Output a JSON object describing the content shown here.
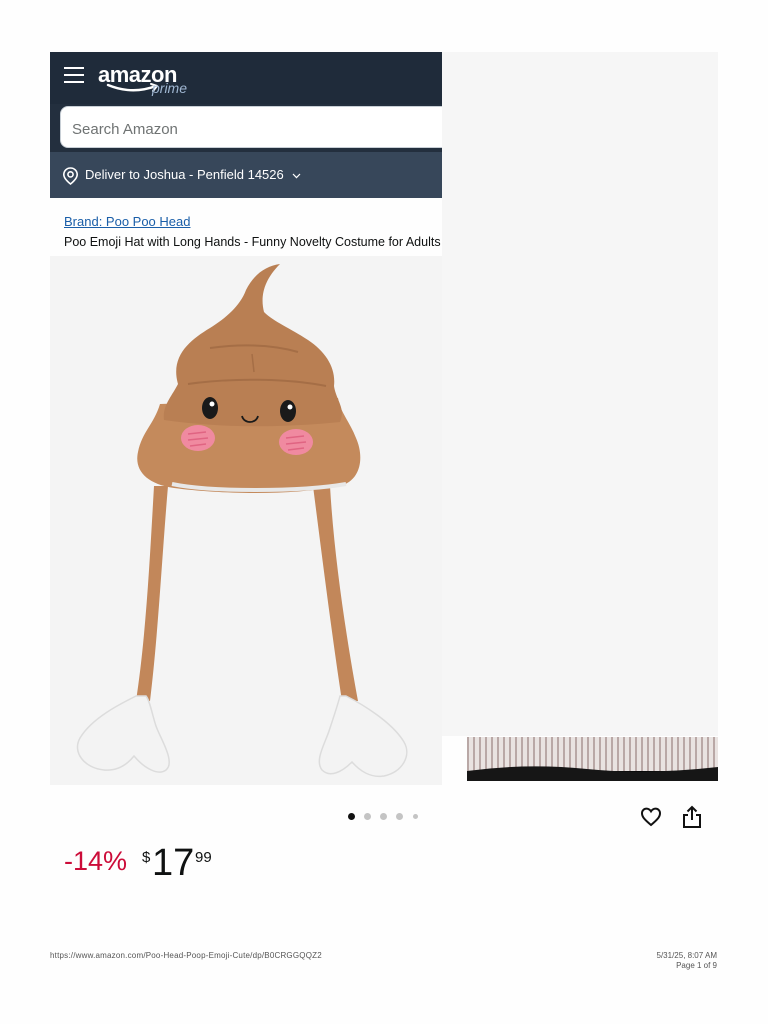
{
  "header": {
    "logo_text": "amazon",
    "logo_sub": "prime",
    "search_placeholder": "Search Amazon",
    "deliver_text": "Deliver to Joshua - Penfield 14526"
  },
  "product": {
    "brand_link": "Brand: Poo Poo Head",
    "title": "Poo Emoji Hat with Long Hands - Funny Novelty Costume for Adults and Kids",
    "image_count": 5,
    "active_image": 1,
    "discount": "-14%",
    "currency": "$",
    "price_whole": "17",
    "price_fraction": "99"
  },
  "colors": {
    "header_bg": "#232f3e",
    "deliver_bg": "#37475a",
    "discount": "#cc0c39",
    "link": "#1a5ea8"
  },
  "footer": {
    "url": "https://www.amazon.com/Poo-Head-Poop-Emoji-Cute/dp/B0CRGGQQZ2",
    "datetime": "5/31/25, 8:07 AM",
    "page": "Page 1 of 9"
  }
}
